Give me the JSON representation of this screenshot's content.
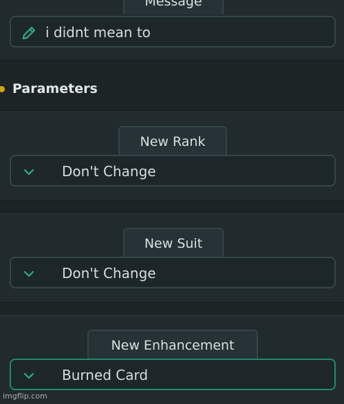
{
  "message": {
    "tab_label": "Message",
    "value": "i didnt mean to",
    "icon": "pencil-icon"
  },
  "section": {
    "title": "Parameters",
    "dot_color": "#d4a514"
  },
  "params": [
    {
      "tab_label": "New Rank",
      "value": "Don't Change",
      "icon": "chevron-down-icon"
    },
    {
      "tab_label": "New Suit",
      "value": "Don't Change",
      "icon": "chevron-down-icon"
    },
    {
      "tab_label": "New Enhancement",
      "value": "Burned Card",
      "icon": "chevron-down-icon"
    }
  ],
  "colors": {
    "accent": "#1f8a6e",
    "icon_green": "#2fae85"
  },
  "watermark": "imgflip.com"
}
